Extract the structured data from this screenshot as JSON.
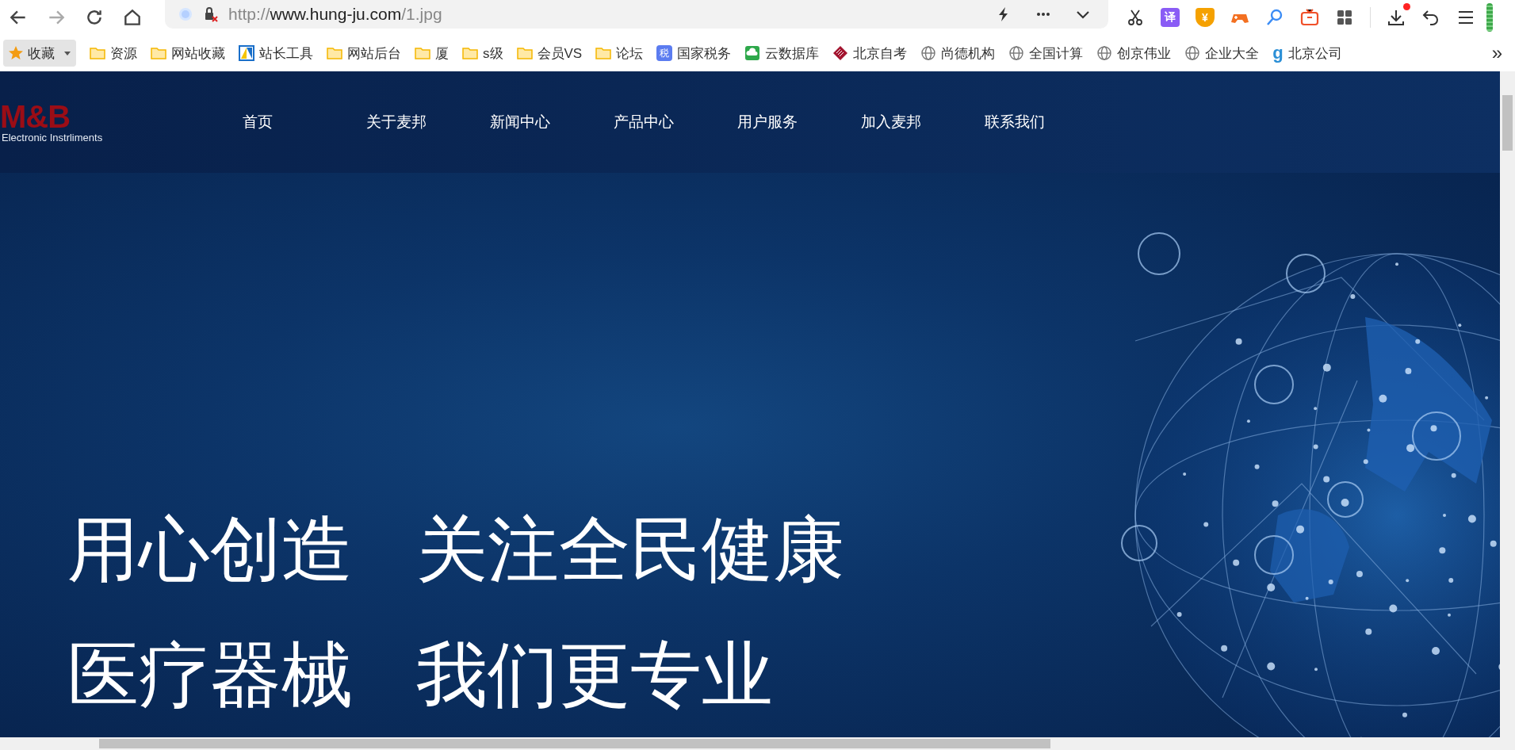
{
  "browser": {
    "url_scheme": "http://",
    "url_host": "www.hung-ju.com",
    "url_path": "/1.jpg",
    "extensions": [
      {
        "kind": "scissors"
      },
      {
        "kind": "translate",
        "glyph": "译"
      },
      {
        "kind": "coin",
        "glyph": "¥"
      },
      {
        "kind": "gamepad"
      },
      {
        "kind": "search"
      },
      {
        "kind": "tv"
      },
      {
        "kind": "apps"
      }
    ],
    "download_badge": true
  },
  "bookmarks": {
    "favorites_label": "收藏",
    "overflow": "»",
    "items": [
      {
        "kind": "folder",
        "label": "资源"
      },
      {
        "kind": "folder",
        "label": "网站收藏"
      },
      {
        "kind": "tool",
        "label": "站长工具"
      },
      {
        "kind": "folder",
        "label": "网站后台"
      },
      {
        "kind": "folder",
        "label": "厦"
      },
      {
        "kind": "folder",
        "label": "s级"
      },
      {
        "kind": "folder",
        "label": "会员VS"
      },
      {
        "kind": "folder",
        "label": "论坛"
      },
      {
        "kind": "tax",
        "label": "国家税务",
        "glyph": "税"
      },
      {
        "kind": "cloud",
        "label": "云数据库"
      },
      {
        "kind": "emblem",
        "label": "北京自考"
      },
      {
        "kind": "globe",
        "label": "尚德机构"
      },
      {
        "kind": "globe",
        "label": "全国计算"
      },
      {
        "kind": "globe",
        "label": "创京伟业"
      },
      {
        "kind": "globe",
        "label": "企业大全"
      },
      {
        "kind": "letter",
        "label": "北京公司",
        "glyph": "g"
      }
    ]
  },
  "site": {
    "logo": {
      "mark": "M&B",
      "tagline": "Electronic Instrliments"
    },
    "nav": [
      "首页",
      "关于麦邦",
      "新闻中心",
      "产品中心",
      "用户服务",
      "加入麦邦",
      "联系我们"
    ],
    "hero": {
      "lines": [
        [
          "用心创造",
          "关注全民健康"
        ],
        [
          "医疗器械",
          "我们更专业"
        ]
      ]
    }
  }
}
